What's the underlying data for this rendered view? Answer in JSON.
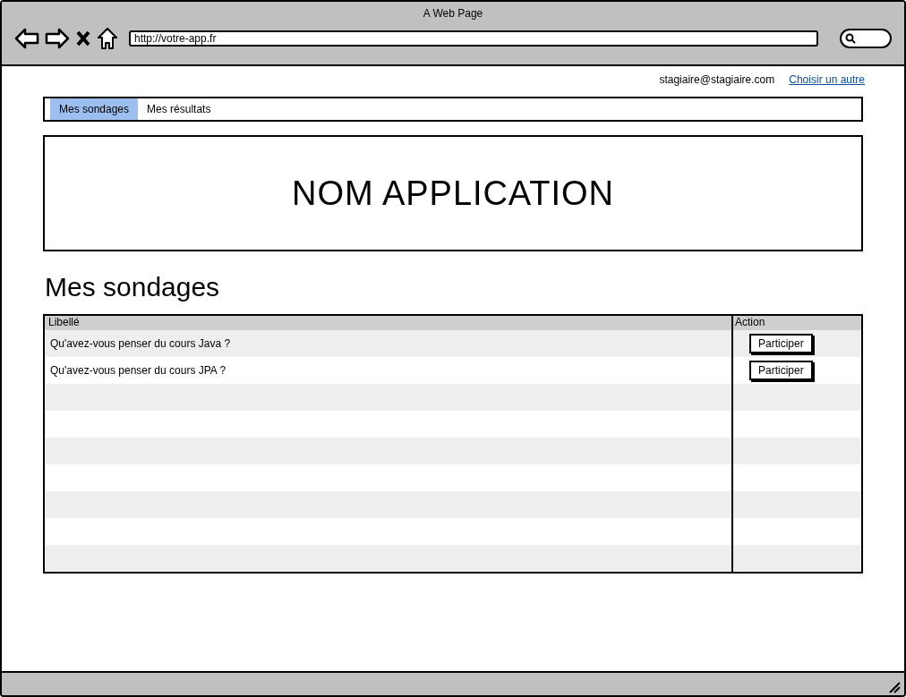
{
  "window": {
    "title": "A Web Page"
  },
  "address_bar": {
    "value": "http://votre-app.fr"
  },
  "user": {
    "email": "stagiaire@stagiaire.com",
    "link": "Choisir un autre"
  },
  "tabs": [
    {
      "label": "Mes sondages",
      "selected": true
    },
    {
      "label": "Mes résultats",
      "selected": false
    }
  ],
  "banner": {
    "title": "NOM APPLICATION"
  },
  "section": {
    "heading": "Mes sondages"
  },
  "table": {
    "columns": [
      "Libellé",
      "Action"
    ],
    "rows": [
      {
        "label": "Qu'avez-vous penser du cours Java ?",
        "action": "Participer"
      },
      {
        "label": "Qu'avez-vous penser du cours JPA ?",
        "action": "Participer"
      }
    ]
  }
}
